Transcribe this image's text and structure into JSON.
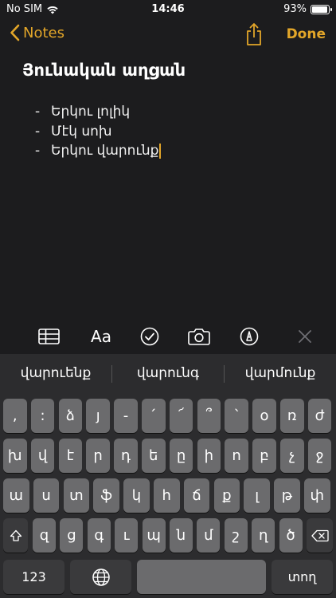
{
  "status": {
    "carrier": "No SIM",
    "time": "14:46",
    "battery": "93%"
  },
  "nav": {
    "back_label": "Notes",
    "done_label": "Done"
  },
  "note": {
    "title": "Յունական աղցան",
    "items": [
      "Երկու լոլիկ",
      "Մէկ սոխ",
      "Երկու վարունք"
    ]
  },
  "toolbar": {
    "format_label": "Aa"
  },
  "keyboard": {
    "suggestions": [
      "վարուենք",
      "վարունգ",
      "վարմունք"
    ],
    "row1": [
      ",",
      ":",
      "ձ",
      "յ",
      "-",
      "՛",
      "՜",
      "՞",
      "՝",
      "օ",
      "ռ",
      "ժ"
    ],
    "row2": [
      "խ",
      "վ",
      "է",
      "ր",
      "դ",
      "ե",
      "ը",
      "ի",
      "ո",
      "բ",
      "չ",
      "ջ"
    ],
    "row3": [
      "ա",
      "ս",
      "տ",
      "ֆ",
      "կ",
      "հ",
      "ճ",
      "ք",
      "լ",
      "թ",
      "փ"
    ],
    "row4": [
      "զ",
      "ց",
      "գ",
      "ւ",
      "պ",
      "ն",
      "մ",
      "շ",
      "ղ",
      "ծ"
    ],
    "numbers_label": "123",
    "return_label": "տող"
  },
  "colors": {
    "accent": "#e3a629",
    "keyboard_bg": "#2c2c2e",
    "key": "#6b6b6d"
  }
}
